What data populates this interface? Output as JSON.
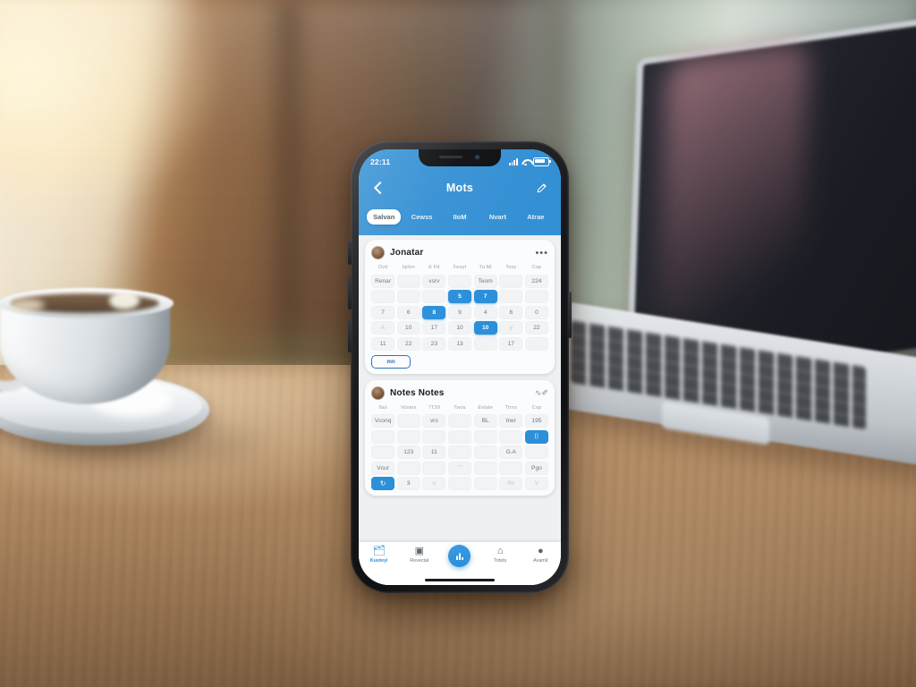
{
  "scene": {
    "description": "smartphone-on-wooden-desk-with-coffee-and-laptop"
  },
  "phone": {
    "status_bar": {
      "time": "22:11",
      "signal_icon": "cellular-signal-icon",
      "wifi_icon": "wifi-icon",
      "battery_icon": "battery-icon"
    },
    "navbar": {
      "back_icon": "chevron-left-icon",
      "title": "Mots",
      "edit_icon": "pencil-icon"
    },
    "tabs": [
      {
        "label": "Salvan",
        "active": true
      },
      {
        "label": "Cewss",
        "active": false
      },
      {
        "label": "IIoM",
        "active": false
      },
      {
        "label": "Nvart",
        "active": false
      },
      {
        "label": "Atrae",
        "active": false
      }
    ],
    "cards": [
      {
        "avatar": "user-avatar",
        "title": "Jonatar",
        "menu_icon": "more-options-icon",
        "weekdays": [
          "Dvd",
          "bjöbn",
          "E Fd",
          "Feeyt",
          "Tu Mi",
          "Toxy",
          "Cop"
        ],
        "rows": [
          [
            {
              "text": "Renar",
              "state": "normal"
            },
            {
              "text": "",
              "state": "blank"
            },
            {
              "text": "vsrv",
              "state": "normal"
            },
            {
              "text": "",
              "state": "blank"
            },
            {
              "text": "Teom",
              "state": "normal"
            },
            {
              "text": "",
              "state": "blank"
            },
            {
              "text": "224",
              "state": "normal"
            }
          ],
          [
            {
              "text": "",
              "state": "blank"
            },
            {
              "text": "",
              "state": "blank"
            },
            {
              "text": "",
              "state": "blank"
            },
            {
              "text": "5",
              "state": "selected"
            },
            {
              "text": "7",
              "state": "selected"
            },
            {
              "text": "",
              "state": "blank"
            },
            {
              "text": "",
              "state": "blank"
            }
          ],
          [
            {
              "text": "7",
              "state": "normal"
            },
            {
              "text": "6",
              "state": "normal"
            },
            {
              "text": "8",
              "state": "selected"
            },
            {
              "text": "9",
              "state": "normal"
            },
            {
              "text": "4",
              "state": "normal"
            },
            {
              "text": "6",
              "state": "normal"
            },
            {
              "text": "0",
              "state": "normal"
            }
          ],
          [
            {
              "text": "A",
              "state": "faint"
            },
            {
              "text": "10",
              "state": "normal"
            },
            {
              "text": "17",
              "state": "normal"
            },
            {
              "text": "10",
              "state": "normal"
            },
            {
              "text": "10",
              "state": "selected"
            },
            {
              "text": "y",
              "state": "faint"
            },
            {
              "text": "22",
              "state": "normal"
            }
          ],
          [
            {
              "text": "11",
              "state": "normal"
            },
            {
              "text": "22",
              "state": "normal"
            },
            {
              "text": "23",
              "state": "normal"
            },
            {
              "text": "13",
              "state": "normal"
            },
            {
              "text": "",
              "state": "blank"
            },
            {
              "text": "17",
              "state": "normal"
            },
            {
              "text": "",
              "state": "blank"
            }
          ]
        ],
        "pill_label": "mn"
      },
      {
        "avatar": "user-avatar",
        "title": "Notes Notes",
        "menu_icon": "scribble-icon",
        "weekdays": [
          "Ilaó",
          "Voxtes",
          "7T39",
          "Twos",
          "Enlate",
          "Ttrns",
          "Cop"
        ],
        "rows": [
          [
            {
              "text": "Vconq",
              "state": "normal"
            },
            {
              "text": "",
              "state": "blank"
            },
            {
              "text": "vrs",
              "state": "normal"
            },
            {
              "text": "",
              "state": "blank"
            },
            {
              "text": "BL",
              "state": "normal"
            },
            {
              "text": "trwr",
              "state": "normal"
            },
            {
              "text": "195",
              "state": "normal"
            }
          ],
          [
            {
              "text": "",
              "state": "blank"
            },
            {
              "text": "",
              "state": "blank"
            },
            {
              "text": "",
              "state": "blank"
            },
            {
              "text": "",
              "state": "blank"
            },
            {
              "text": "",
              "state": "blank"
            },
            {
              "text": "",
              "state": "blank"
            },
            {
              "text": "⌷",
              "state": "icon"
            }
          ],
          [
            {
              "text": "",
              "state": "blank"
            },
            {
              "text": "123",
              "state": "normal"
            },
            {
              "text": "11",
              "state": "normal"
            },
            {
              "text": "",
              "state": "blank"
            },
            {
              "text": "",
              "state": "blank"
            },
            {
              "text": "G.A",
              "state": "normal"
            },
            {
              "text": "",
              "state": "blank"
            }
          ],
          [
            {
              "text": "Vcur",
              "state": "normal"
            },
            {
              "text": "",
              "state": "blank"
            },
            {
              "text": "",
              "state": "blank"
            },
            {
              "text": "⌒",
              "state": "faint"
            },
            {
              "text": "",
              "state": "blank"
            },
            {
              "text": "",
              "state": "blank"
            },
            {
              "text": "Pgo",
              "state": "normal"
            }
          ],
          [
            {
              "text": "↻",
              "state": "icon"
            },
            {
              "text": "3",
              "state": "normal"
            },
            {
              "text": "n",
              "state": "faint"
            },
            {
              "text": "",
              "state": "blank"
            },
            {
              "text": "",
              "state": "blank"
            },
            {
              "text": "Rc",
              "state": "faint"
            },
            {
              "text": "V",
              "state": "faint"
            }
          ]
        ]
      }
    ],
    "bottom_nav": [
      {
        "icon": "🗂",
        "icon_name": "briefcase-icon",
        "label": "Kuuteyi",
        "active": true
      },
      {
        "icon": "▣",
        "icon_name": "grid-icon",
        "label": "Revectal",
        "active": false
      },
      {
        "icon": "ὌA",
        "icon_name": "chart-fab-icon",
        "label": "",
        "active": false,
        "fab": true
      },
      {
        "icon": "⌂",
        "icon_name": "tag-icon",
        "label": "Totsts",
        "active": false
      },
      {
        "icon": "●",
        "icon_name": "person-icon",
        "label": "Avamš",
        "active": false
      }
    ],
    "home_indicator": "home-indicator"
  },
  "colors": {
    "header_blue": "#3490d4",
    "accent_blue": "#2b8fd9",
    "card_bg": "#fbfcfd",
    "content_bg": "#eef0f2"
  }
}
